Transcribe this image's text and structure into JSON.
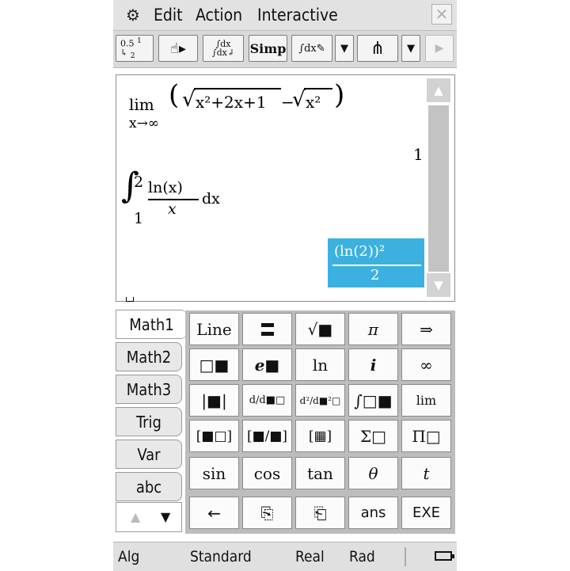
{
  "menubar": {
    "gear_icon": "gear-icon",
    "items": [
      "Edit",
      "Action",
      "Interactive"
    ],
    "close_label": "✕"
  },
  "toolbar": {
    "buttons": [
      {
        "name": "fraction-decimal-toggle",
        "label": "0.5 ½"
      },
      {
        "name": "hand-stylus-tool",
        "label": "☝▸"
      },
      {
        "name": "integral-swap",
        "label": "∫dx ∫dx"
      },
      {
        "name": "simp",
        "label": "Simp"
      },
      {
        "name": "integral-edit",
        "label": "∫dx"
      },
      {
        "name": "dropdown-1",
        "label": "▼"
      },
      {
        "name": "graph",
        "label": "Ψ"
      },
      {
        "name": "dropdown-2",
        "label": "▼"
      },
      {
        "name": "play",
        "label": "▶"
      }
    ]
  },
  "work": {
    "lim_label": "lim",
    "lim_sub": "x→∞",
    "expr1": "x²+2x+1",
    "expr2": "x²",
    "result1": "1",
    "integral_upper": "2",
    "integral_lower": "1",
    "integrand_num": "ln(x)",
    "integrand_den": "x",
    "integrand_dx": "dx",
    "result2_num": "(ln(2))²",
    "result2_den": "2"
  },
  "keypad": {
    "tabs": [
      "Math1",
      "Math2",
      "Math3",
      "Trig",
      "Var",
      "abc"
    ],
    "active_tab": "Math1",
    "keys": [
      [
        "Line",
        "▬",
        "√■",
        "π",
        "⇒"
      ],
      [
        "□■",
        "e■",
        "ln",
        "i",
        "∞"
      ],
      [
        "|■|",
        "d/d■□",
        "d²/d■²□",
        "∫□■",
        "lim"
      ],
      [
        "[■□]",
        "[■/■]",
        "[▦]",
        "Σ□",
        "Π□"
      ],
      [
        "sin",
        "cos",
        "tan",
        "θ",
        "t"
      ],
      [
        "←",
        "⎘",
        "⎗",
        "ans",
        "EXE"
      ]
    ]
  },
  "status": {
    "mode": "Alg",
    "format": "Standard",
    "domain": "Real",
    "angle": "Rad"
  }
}
